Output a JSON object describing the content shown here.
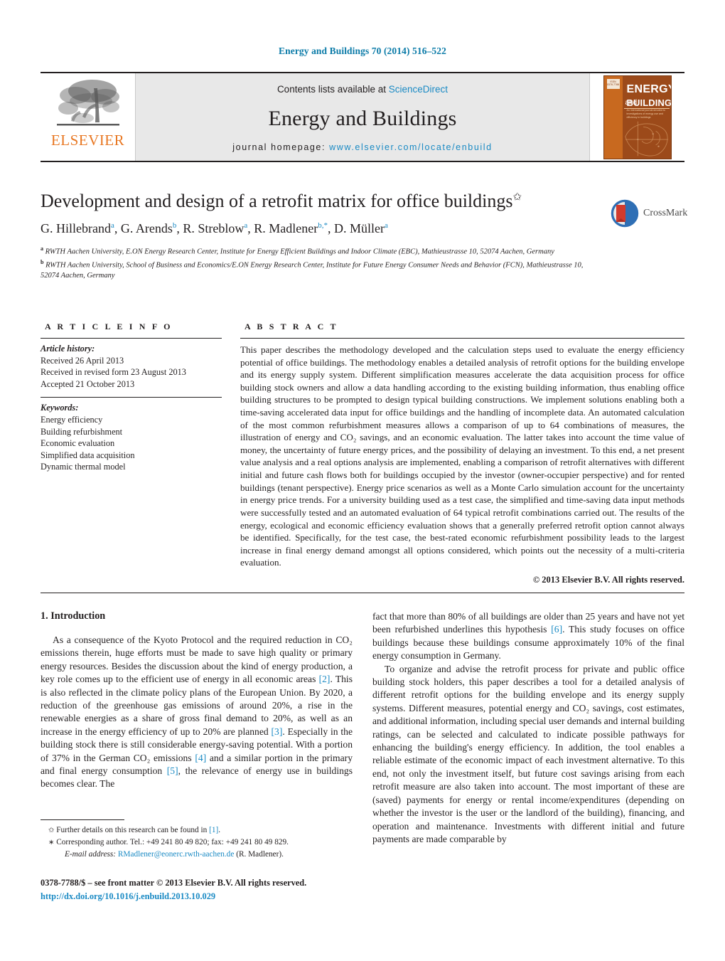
{
  "running_head": "Energy and Buildings 70 (2014) 516–522",
  "masthead": {
    "publisher_name": "ELSEVIER",
    "contents_prefix": "Contents lists available at ",
    "contents_link": "ScienceDirect",
    "journal_name": "Energy and Buildings",
    "homepage_label": "journal homepage: ",
    "homepage_url": "www.elsevier.com/locate/enbuild",
    "cover": {
      "brand_top": "ENERGY",
      "brand_and": "and",
      "brand_bottom": "BUILDINGS",
      "badge": "ISSN 0378-7788",
      "subtitle": "An international journal devoted to investigations of energy use and efficiency in buildings"
    }
  },
  "article": {
    "title": "Development and design of a retrofit matrix for office buildings",
    "title_footnote_mark": "✩",
    "authors": [
      {
        "name": "G. Hillebrand",
        "sup": "a"
      },
      {
        "name": "G. Arends",
        "sup": "b"
      },
      {
        "name": "R. Streblow",
        "sup": "a"
      },
      {
        "name": "R. Madlener",
        "sup": "b,*"
      },
      {
        "name": "D. Müller",
        "sup": "a"
      }
    ],
    "affiliations": [
      {
        "mark": "a",
        "text": "RWTH Aachen University, E.ON Energy Research Center, Institute for Energy Efficient Buildings and Indoor Climate (EBC), Mathieustrasse 10, 52074 Aachen, Germany"
      },
      {
        "mark": "b",
        "text": "RWTH Aachen University, School of Business and Economics/E.ON Energy Research Center, Institute for Future Energy Consumer Needs and Behavior (FCN), Mathieustrasse 10, 52074 Aachen, Germany"
      }
    ]
  },
  "crossmark": {
    "label": "CrossMark"
  },
  "article_info": {
    "heading": "A R T I C L E    I N F O",
    "history_label": "Article history:",
    "history": [
      "Received 26 April 2013",
      "Received in revised form 23 August 2013",
      "Accepted 21 October 2013"
    ],
    "keywords_label": "Keywords:",
    "keywords": [
      "Energy efficiency",
      "Building refurbishment",
      "Economic evaluation",
      "Simplified data acquisition",
      "Dynamic thermal model"
    ]
  },
  "abstract": {
    "heading": "A B S T R A C T",
    "text": "This paper describes the methodology developed and the calculation steps used to evaluate the energy efficiency potential of office buildings. The methodology enables a detailed analysis of retrofit options for the building envelope and its energy supply system. Different simplification measures accelerate the data acquisition process for office building stock owners and allow a data handling according to the existing building information, thus enabling office building structures to be prompted to design typical building constructions. We implement solutions enabling both a time-saving accelerated data input for office buildings and the handling of incomplete data. An automated calculation of the most common refurbishment measures allows a comparison of up to 64 combinations of measures, the illustration of energy and CO₂ savings, and an economic evaluation. The latter takes into account the time value of money, the uncertainty of future energy prices, and the possibility of delaying an investment. To this end, a net present value analysis and a real options analysis are implemented, enabling a comparison of retrofit alternatives with different initial and future cash flows both for buildings occupied by the investor (owner-occupier perspective) and for rented buildings (tenant perspective). Energy price scenarios as well as a Monte Carlo simulation account for the uncertainty in energy price trends. For a university building used as a test case, the simplified and time-saving data input methods were successfully tested and an automated evaluation of 64 typical retrofit combinations carried out. The results of the energy, ecological and economic efficiency evaluation shows that a generally preferred retrofit option cannot always be identified. Specifically, for the test case, the best-rated economic refurbishment possibility leads to the largest increase in final energy demand amongst all options considered, which points out the necessity of a multi-criteria evaluation.",
    "copyright": "© 2013 Elsevier B.V. All rights reserved."
  },
  "body": {
    "section_heading": "1.  Introduction",
    "left_paragraphs": [
      "As a consequence of the Kyoto Protocol and the required reduction in CO₂ emissions therein, huge efforts must be made to save high quality or primary energy resources. Besides the discussion about the kind of energy production, a key role comes up to the efficient use of energy in all economic areas [2]. This is also reflected in the climate policy plans of the European Union. By 2020, a reduction of the greenhouse gas emissions of around 20%, a rise in the renewable energies as a share of gross final demand to 20%, as well as an increase in the energy efficiency of up to 20% are planned [3]. Especially in the building stock there is still considerable energy-saving potential. With a portion of 37% in the German CO₂ emissions [4] and a similar portion in the primary and final energy consumption [5], the relevance of energy use in buildings becomes clear. The"
    ],
    "right_paragraphs": [
      "fact that more than 80% of all buildings are older than 25 years and have not yet been refurbished underlines this hypothesis [6]. This study focuses on office buildings because these buildings consume approximately 10% of the final energy consumption in Germany.",
      "To organize and advise the retrofit process for private and public office building stock holders, this paper describes a tool for a detailed analysis of different retrofit options for the building envelope and its energy supply systems. Different measures, potential energy and CO₂ savings, cost estimates, and additional information, including special user demands and internal building ratings, can be selected and calculated to indicate possible pathways for enhancing the building's energy efficiency. In addition, the tool enables a reliable estimate of the economic impact of each investment alternative. To this end, not only the investment itself, but future cost savings arising from each retrofit measure are also taken into account. The most important of these are (saved) payments for energy or rental income/expenditures (depending on whether the investor is the user or the landlord of the building), financing, and operation and maintenance. Investments with different initial and future payments are made comparable by"
    ]
  },
  "footnotes": [
    {
      "mark": "✩",
      "text_before": "Further details on this research can be found in ",
      "link": "[1]",
      "text_after": "."
    },
    {
      "mark": "∗",
      "text_before": "Corresponding author. Tel.: +49 241 80 49 820; fax: +49 241 80 49 829.",
      "link": "",
      "text_after": ""
    }
  ],
  "email_line": {
    "label": "E-mail address:",
    "address": "RMadlener@eonerc.rwth-aachen.de",
    "owner": "(R. Madlener)."
  },
  "imprint": {
    "issn_line": "0378-7788/$ – see front matter © 2013 Elsevier B.V. All rights reserved.",
    "doi": "http://dx.doi.org/10.1016/j.enbuild.2013.10.029"
  },
  "colors": {
    "link_blue": "#1a8ac4",
    "elsevier_orange": "#e87722",
    "masthead_gray": "#e8e8e8",
    "crossmark_red": "#d13b2e",
    "crossmark_blue": "#2f6fb5"
  }
}
